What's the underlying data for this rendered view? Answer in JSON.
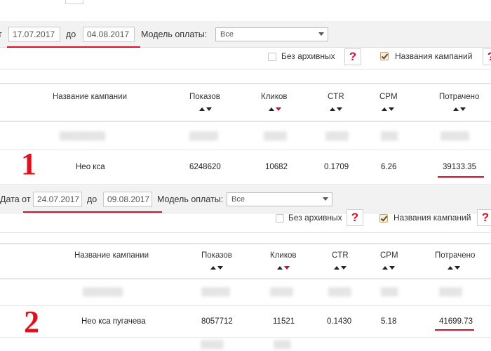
{
  "panel1": {
    "date_from": "17.07.2017",
    "to_label": "до",
    "date_to": "04.08.2017",
    "payment_label": "Модель оплаты:",
    "payment_value": "Все",
    "archive_label": "Без архивных",
    "campaign_names_label": "Названия кампаний",
    "help_glyph": "?",
    "columns": [
      "Название кампании",
      "Показов",
      "Кликов",
      "CTR",
      "CPM",
      "Потрачено"
    ],
    "row": {
      "name": "Нео кса",
      "impressions": "6248620",
      "clicks": "10682",
      "ctr": "0.1709",
      "cpm": "6.26",
      "spent": "39133.35"
    },
    "marker": "1"
  },
  "panel2": {
    "date_from_label": "Дата от",
    "date_from": "24.07.2017",
    "to_label": "до",
    "date_to": "09.08.2017",
    "payment_label": "Модель оплаты:",
    "payment_value": "Все",
    "archive_label": "Без архивных",
    "campaign_names_label": "Названия кампаний",
    "help_glyph": "?",
    "columns": [
      "Название кампании",
      "Показов",
      "Кликов",
      "CTR",
      "CPM",
      "Потрачено"
    ],
    "row": {
      "name": "Нео кса пугачева",
      "impressions": "8057712",
      "clicks": "11521",
      "ctr": "0.1430",
      "cpm": "5.18",
      "spent": "41699.73"
    },
    "marker": "2"
  },
  "colors": {
    "accent_red": "#d6112c",
    "marker_red": "#e0101e",
    "bar_bg": "#f2f2f2"
  }
}
